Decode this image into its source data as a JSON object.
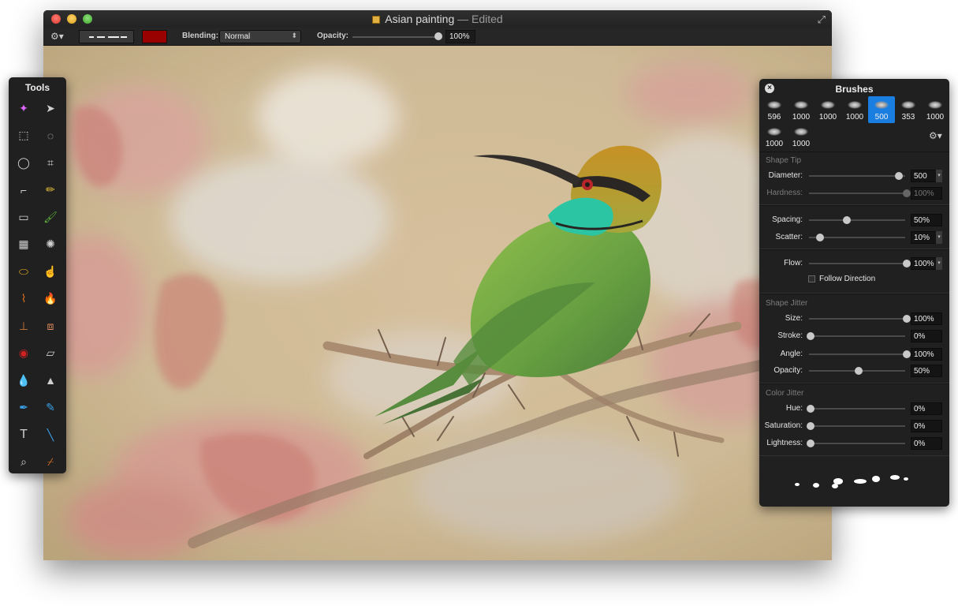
{
  "window": {
    "title": "Asian painting",
    "edited": "— Edited"
  },
  "toolbar": {
    "blending_label": "Blending:",
    "blending_value": "Normal",
    "opacity_label": "Opacity:",
    "opacity_value": "100%",
    "opacity_fraction": 1.0,
    "color": "#990000"
  },
  "tools": {
    "title": "Tools",
    "items": [
      "magic-wand-icon",
      "move-icon",
      "rect-select-icon",
      "ellipse-select-icon",
      "lasso-icon",
      "polygon-lasso-icon",
      "crop-icon",
      "pencil-icon",
      "eraser-icon",
      "paintbrush-icon",
      "gradient-icon",
      "spray-icon",
      "sponge-icon",
      "smudge-icon",
      "broom-icon",
      "burn-icon",
      "stamp-icon",
      "bandage-icon",
      "red-eye-icon",
      "dodge-icon",
      "blur-icon",
      "sharpen-icon",
      "pen-icon",
      "freeform-pen-icon",
      "text-icon",
      "line-icon",
      "zoom-icon",
      "eyedropper-icon"
    ]
  },
  "brushes": {
    "title": "Brushes",
    "presets": [
      "596",
      "1000",
      "1000",
      "1000",
      "500",
      "353",
      "1000",
      "1000",
      "1000"
    ],
    "selected_index": 4,
    "shape_tip": {
      "title": "Shape Tip",
      "diameter_label": "Diameter:",
      "diameter_value": "500",
      "diameter_fraction": 0.92,
      "hardness_label": "Hardness:",
      "hardness_value": "100%",
      "hardness_fraction": 1.0
    },
    "spacing": {
      "spacing_label": "Spacing:",
      "spacing_value": "50%",
      "spacing_fraction": 0.38,
      "scatter_label": "Scatter:",
      "scatter_value": "10%",
      "scatter_fraction": 0.1
    },
    "flow": {
      "flow_label": "Flow:",
      "flow_value": "100%",
      "flow_fraction": 1.0,
      "follow_label": "Follow Direction"
    },
    "shape_jitter": {
      "title": "Shape Jitter",
      "size_label": "Size:",
      "size_value": "100%",
      "size_fraction": 1.0,
      "stroke_label": "Stroke:",
      "stroke_value": "0%",
      "stroke_fraction": 0.0,
      "angle_label": "Angle:",
      "angle_value": "100%",
      "angle_fraction": 1.0,
      "opacity_label": "Opacity:",
      "opacity_value": "50%",
      "opacity_fraction": 0.5
    },
    "color_jitter": {
      "title": "Color Jitter",
      "hue_label": "Hue:",
      "hue_value": "0%",
      "hue_fraction": 0.0,
      "saturation_label": "Saturation:",
      "saturation_value": "0%",
      "saturation_fraction": 0.0,
      "lightness_label": "Lightness:",
      "lightness_value": "0%",
      "lightness_fraction": 0.0
    }
  },
  "colors": {
    "accent": "#1a7ee0",
    "panel": "#202020",
    "bird_green": "#5fa040",
    "bird_teal": "#20c0a0",
    "bird_orange": "#c8902a"
  }
}
